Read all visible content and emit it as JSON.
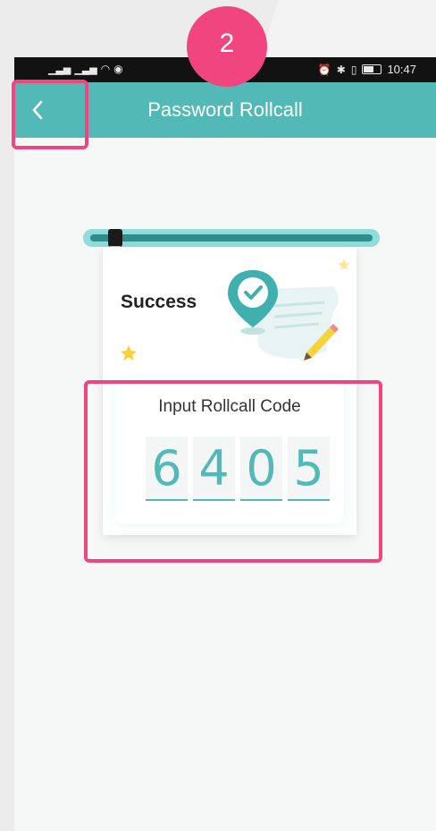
{
  "annotation": {
    "step_badge": "2",
    "highlight_color": "#f0457f"
  },
  "status_bar": {
    "left_icons": [
      "signal-icon",
      "signal-icon",
      "wifi-icon",
      "eye-icon"
    ],
    "left_text": "⁵ıll ⁴ᴳıll",
    "right_icons": [
      "alarm-icon",
      "bluetooth-icon",
      "vibrate-icon",
      "battery-icon"
    ],
    "time": "10:47"
  },
  "header": {
    "title": "Password Rollcall",
    "back_icon": "chevron-left-icon",
    "background_color": "#52b9b7"
  },
  "card": {
    "success_label": "Success",
    "input_label": "Input Rollcall Code",
    "code_digits": [
      "6",
      "4",
      "0",
      "5"
    ],
    "accent_color": "#52b9b7"
  }
}
